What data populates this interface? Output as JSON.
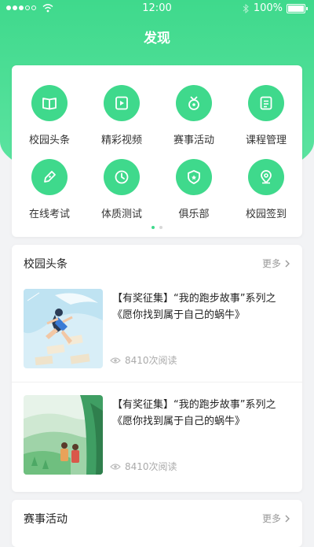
{
  "status_bar": {
    "time": "12:00",
    "battery": "100%"
  },
  "header": {
    "title": "发现"
  },
  "colors": {
    "accent": "#3fd98c",
    "background": "#f2f3f5"
  },
  "quick_menu": {
    "items": [
      {
        "label": "校园头条",
        "icon": "book-icon"
      },
      {
        "label": "精彩视频",
        "icon": "video-icon"
      },
      {
        "label": "赛事活动",
        "icon": "medal-icon"
      },
      {
        "label": "课程管理",
        "icon": "clipboard-icon"
      },
      {
        "label": "在线考试",
        "icon": "pen-icon"
      },
      {
        "label": "体质测试",
        "icon": "clock-icon"
      },
      {
        "label": "俱乐部",
        "icon": "shield-icon"
      },
      {
        "label": "校园签到",
        "icon": "location-icon"
      }
    ],
    "page_count": 2,
    "active_page": 1
  },
  "campus_news": {
    "title": "校园头条",
    "more": "更多",
    "articles": [
      {
        "title": "【有奖征集】“我的跑步故事”系列之《愿你找到属于自己的蜗牛》",
        "views": "8410次阅读"
      },
      {
        "title": "【有奖征集】“我的跑步故事”系列之《愿你找到属于自己的蜗牛》",
        "views": "8410次阅读"
      }
    ]
  },
  "events": {
    "title": "赛事活动",
    "more": "更多"
  }
}
